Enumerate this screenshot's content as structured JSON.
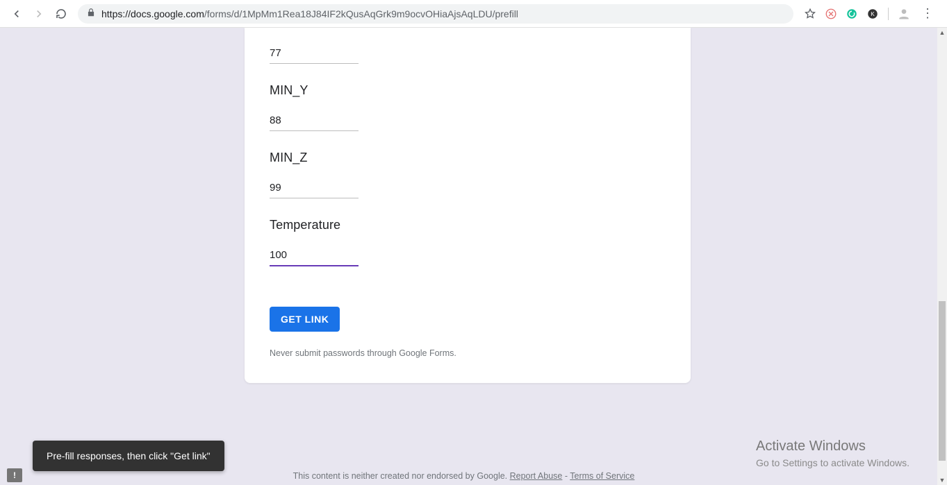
{
  "browser": {
    "url_host": "https://docs.google.com",
    "url_path": "/forms/d/1MpMm1Rea18J84IF2kQusAqGrk9m9ocvOHiaAjsAqLDU/prefill"
  },
  "form": {
    "fields": [
      {
        "label": "",
        "value": "77",
        "focused": false
      },
      {
        "label": "MIN_Y",
        "value": "88",
        "focused": false
      },
      {
        "label": "MIN_Z",
        "value": "99",
        "focused": false
      },
      {
        "label": "Temperature",
        "value": "100",
        "focused": true
      }
    ],
    "submit_label": "GET LINK",
    "disclaimer": "Never submit passwords through Google Forms."
  },
  "footer": {
    "text_pre": "This content is neither created nor endorsed by Google. ",
    "link1": "Report Abuse",
    "sep": " - ",
    "link2": "Terms of Service"
  },
  "toast": {
    "text": "Pre-fill responses, then click \"Get link\""
  },
  "watermark": {
    "title": "Activate Windows",
    "subtitle": "Go to Settings to activate Windows."
  }
}
